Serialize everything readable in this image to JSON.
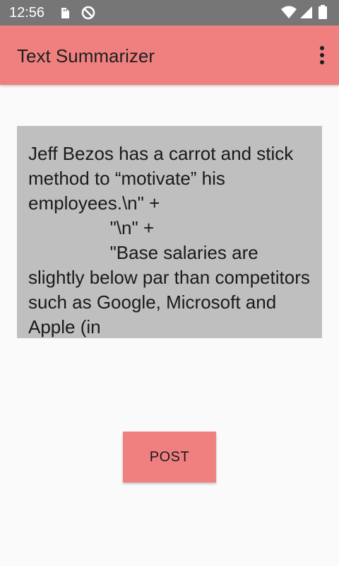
{
  "status_bar": {
    "time": "12:56",
    "left_icons": [
      "sd-card-icon",
      "no-sync-icon"
    ],
    "right_icons": [
      "wifi-icon",
      "signal-icon",
      "battery-icon"
    ]
  },
  "app_bar": {
    "title": "Text Summarizer",
    "menu_icon": "overflow-menu-icon",
    "background_color": "#f08080"
  },
  "input": {
    "value": "Jeff Bezos has a carrot and stick method to “motivate” his employees.\\n\" +\n                \"\\n\" +\n                \"Base salaries are slightly below par than competitors such as Google, Microsoft and Apple (in",
    "background_color": "#bfbfbf"
  },
  "post_button": {
    "label": "POST",
    "background_color": "#f08080"
  }
}
